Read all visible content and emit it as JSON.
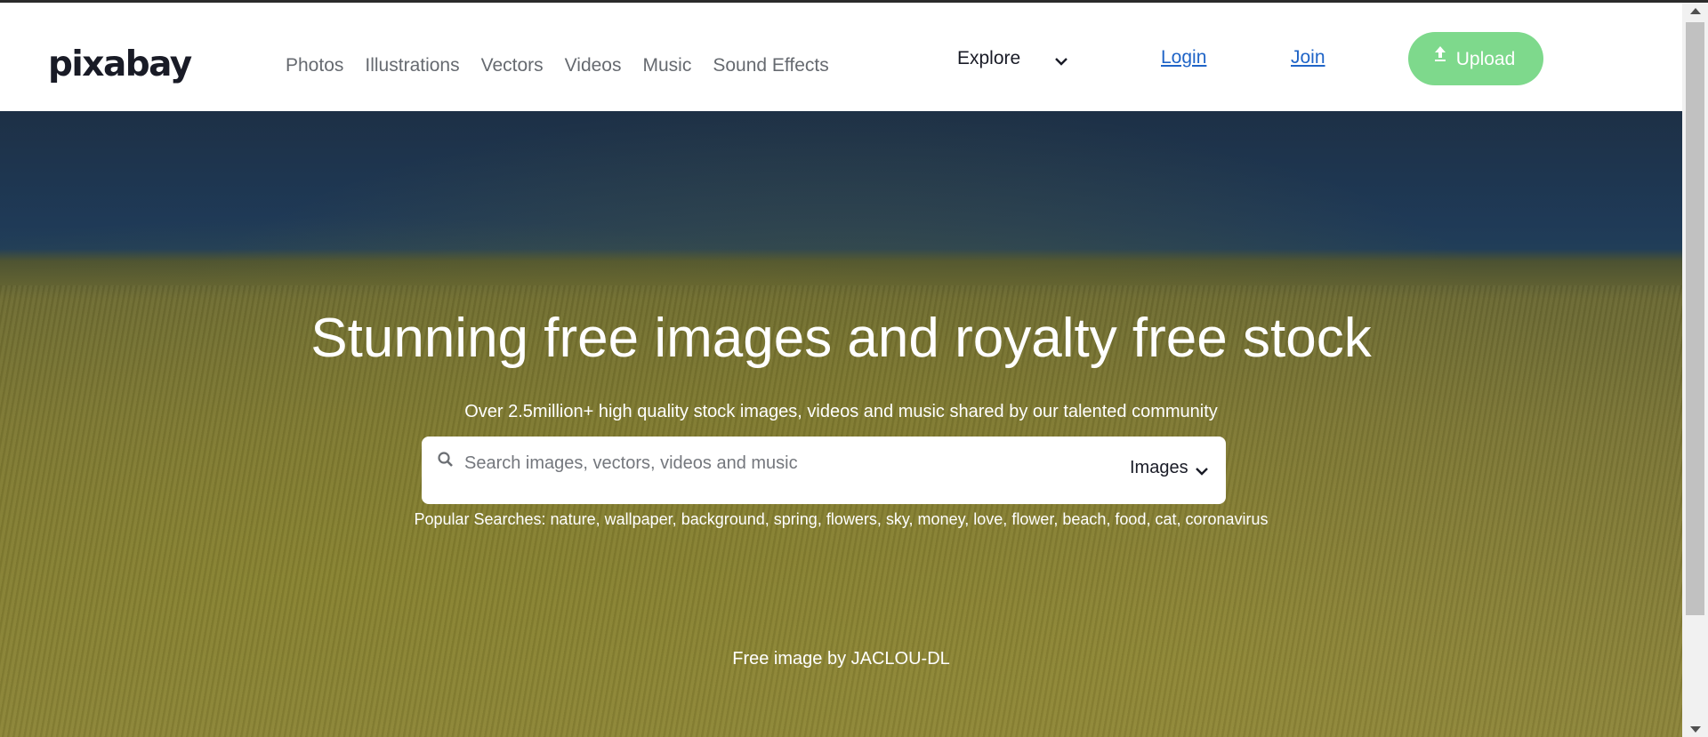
{
  "header": {
    "logo_text": "pixabay",
    "nav": [
      "Photos",
      "Illustrations",
      "Vectors",
      "Videos",
      "Music",
      "Sound Effects"
    ],
    "explore_label": "Explore",
    "login_label": "Login",
    "join_label": "Join",
    "upload_label": "Upload"
  },
  "hero": {
    "title": "Stunning free images and royalty free stock",
    "subtitle": "Over 2.5million+ high quality stock images, videos and music shared by our talented community",
    "search": {
      "placeholder": "Search images, vectors, videos and music",
      "type_selected": "Images"
    },
    "popular_label": "Popular Searches:",
    "popular_terms": [
      "nature",
      "wallpaper",
      "background",
      "spring",
      "flowers",
      "sky",
      "money",
      "love",
      "flower",
      "beach",
      "food",
      "cat",
      "coronavirus"
    ],
    "credit": "Free image by JACLOU-DL"
  },
  "colors": {
    "upload_button": "#7ed98c",
    "link": "#1f64c7",
    "nav_text": "#666a70"
  },
  "icons": [
    "chevron-down-icon",
    "upload-arrow-icon",
    "search-icon"
  ]
}
